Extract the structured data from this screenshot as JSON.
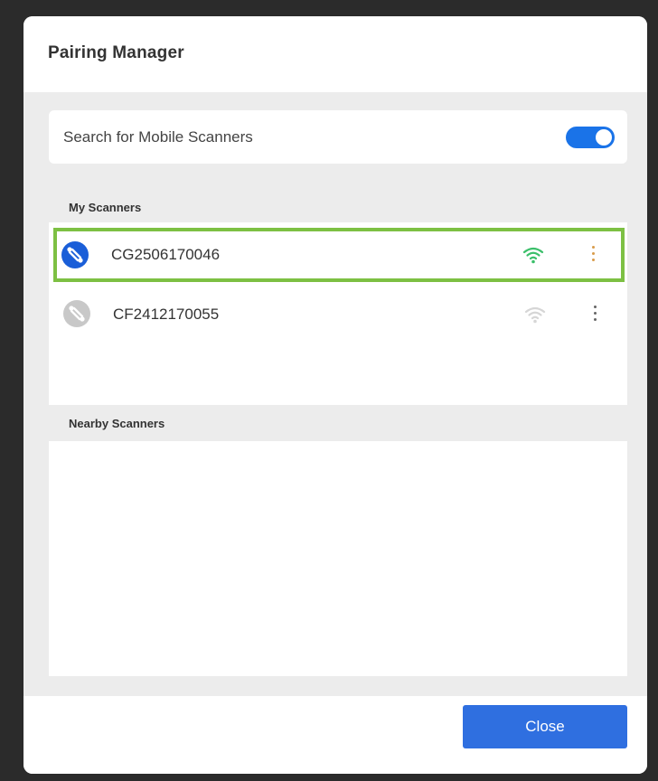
{
  "dialog": {
    "title": "Pairing Manager"
  },
  "search": {
    "label": "Search for Mobile Scanners",
    "toggle_on": true
  },
  "sections": {
    "my_scanners": "My Scanners",
    "nearby_scanners": "Nearby Scanners"
  },
  "my_scanners": [
    {
      "name": "CG2506170046",
      "connected": true,
      "selected": true,
      "icon": "scanner-connected-icon",
      "wifi": "wifi-icon"
    },
    {
      "name": "CF2412170055",
      "connected": false,
      "selected": false,
      "icon": "scanner-disconnected-icon",
      "wifi": "wifi-icon"
    }
  ],
  "nearby_scanners": [],
  "footer": {
    "close_label": "Close"
  },
  "colors": {
    "accent": "#1a73e8",
    "selection_border": "#7dc043",
    "wifi_connected": "#3bbf6a",
    "wifi_disconnected": "#d0d0d0",
    "button": "#2f6fe0"
  }
}
